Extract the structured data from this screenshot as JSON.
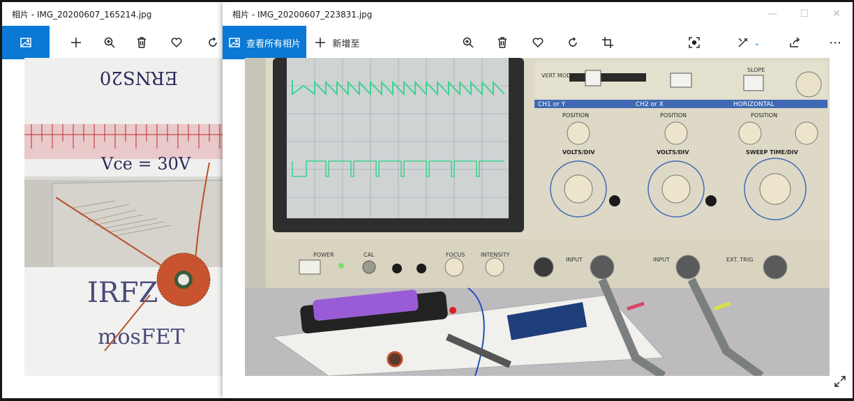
{
  "windows": {
    "left": {
      "title": "相片 - IMG_20200607_165214.jpg",
      "toolbar": [
        "view-photo-icon",
        "add-icon",
        "zoom-in-icon",
        "delete-icon",
        "favorite-icon",
        "rotate-icon"
      ],
      "photo_text": {
        "line1": "ERNS20",
        "line2": "Vce = 30V",
        "line3": "IRFZ",
        "line4": "mosFET"
      }
    },
    "right": {
      "title": "相片 - IMG_20200607_223831.jpg",
      "view_all_label": "查看所有相片",
      "add_to_label": "新增至",
      "accent_color": "#0a78d4",
      "scope_labels": {
        "ch1": "CH1 or Y",
        "ch2": "CH2 or X",
        "horizontal": "HORIZONTAL",
        "position": "POSITION",
        "volts_div": "VOLTS/DIV",
        "sweep": "SWEEP TIME/DIV",
        "power": "POWER",
        "cal": "CAL",
        "focus": "FOCUS",
        "intensity": "INTENSITY",
        "input": "INPUT",
        "vert_mode": "VERT MODE",
        "slope": "SLOPE",
        "ext_trig": "EXT. TRIG"
      }
    }
  }
}
